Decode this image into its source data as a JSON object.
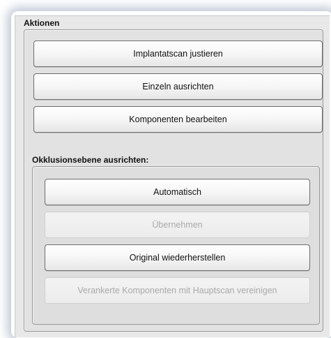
{
  "section": {
    "title": "Aktionen",
    "buttons": [
      {
        "label": "Implantatscan justieren",
        "enabled": true
      },
      {
        "label": "Einzeln ausrichten",
        "enabled": true
      },
      {
        "label": "Komponenten bearbeiten",
        "enabled": true
      }
    ]
  },
  "occlusion": {
    "title": "Okklusionsebene ausrichten:",
    "buttons": [
      {
        "label": "Automatisch",
        "enabled": true
      },
      {
        "label": "Übernehmen",
        "enabled": false
      },
      {
        "label": "Original wiederherstellen",
        "enabled": true
      },
      {
        "label": "Verankerte Komponenten mit Hauptscan vereinigen",
        "enabled": false
      }
    ]
  },
  "colors": {
    "panel_background": "#e8e8e8",
    "button_border": "#6c6c6c",
    "disabled_text": "#a9a9a9"
  }
}
